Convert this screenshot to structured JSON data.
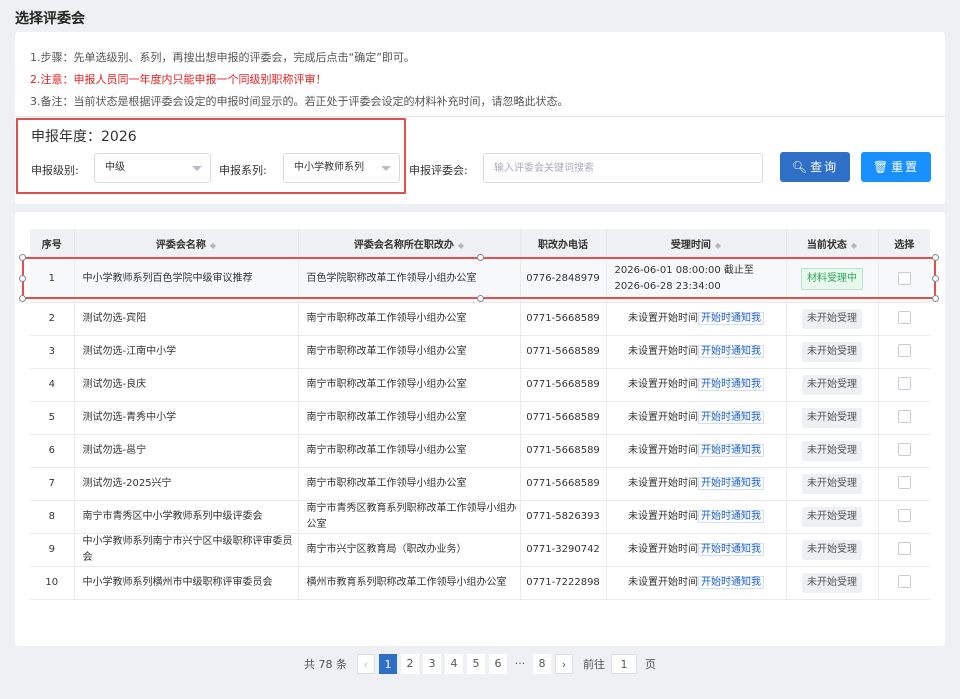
{
  "page_title": "选择评委会",
  "notes": {
    "step": "1.步骤：先单选级别、系列，再搜出想申报的评委会，完成后点击“确定”即可。",
    "warning": "2.注意：申报人员同一年度内只能申报一个同级别职称评审！",
    "remark": "3.备注：当前状态是根据评委会设定的申报时间显示的。若正处于评委会设定的材料补充时间，请忽略此状态。"
  },
  "filters": {
    "year_label": "申报年度：2026",
    "level_label": "申报级别:",
    "level_value": "中级",
    "series_label": "申报系列:",
    "series_value": "中小学教师系列",
    "committee_label": "申报评委会:",
    "committee_placeholder": "输入评委会关键词搜索",
    "query_button": "查询",
    "reset_button": "重置"
  },
  "table": {
    "headers": {
      "index": "序号",
      "name": "评委会名称",
      "office": "评委会名称所在职改办",
      "phone": "职改办电话",
      "time": "受理时间",
      "status": "当前状态",
      "select": "选择"
    },
    "rows": [
      {
        "index": "1",
        "name": "中小学教师系列百色学院中级审议推荐",
        "office": "百色学院职称改革工作领导小组办公室",
        "phone": "0776-2848979",
        "time": "2026-06-01 08:00:00 截止至 2026-06-28 23:34:00",
        "link": "",
        "status": "材料受理中"
      },
      {
        "index": "2",
        "name": "测试勿选-宾阳",
        "office": "南宁市职称改革工作领导小组办公室",
        "phone": "0771-5668589",
        "time": "未设置开始时间",
        "link": "开始时通知我",
        "status": "未开始受理"
      },
      {
        "index": "3",
        "name": "测试勿选-江南中小学",
        "office": "南宁市职称改革工作领导小组办公室",
        "phone": "0771-5668589",
        "time": "未设置开始时间",
        "link": "开始时通知我",
        "status": "未开始受理"
      },
      {
        "index": "4",
        "name": "测试勿选-良庆",
        "office": "南宁市职称改革工作领导小组办公室",
        "phone": "0771-5668589",
        "time": "未设置开始时间",
        "link": "开始时通知我",
        "status": "未开始受理"
      },
      {
        "index": "5",
        "name": "测试勿选-青秀中小学",
        "office": "南宁市职称改革工作领导小组办公室",
        "phone": "0771-5668589",
        "time": "未设置开始时间",
        "link": "开始时通知我",
        "status": "未开始受理"
      },
      {
        "index": "6",
        "name": "测试勿选-邕宁",
        "office": "南宁市职称改革工作领导小组办公室",
        "phone": "0771-5668589",
        "time": "未设置开始时间",
        "link": "开始时通知我",
        "status": "未开始受理"
      },
      {
        "index": "7",
        "name": "测试勿选-2025兴宁",
        "office": "南宁市职称改革工作领导小组办公室",
        "phone": "0771-5668589",
        "time": "未设置开始时间",
        "link": "开始时通知我",
        "status": "未开始受理"
      },
      {
        "index": "8",
        "name": "南宁市青秀区中小学教师系列中级评委会",
        "office": "南宁市青秀区教育系列职称改革工作领导小组办公室",
        "phone": "0771-5826393",
        "time": "未设置开始时间",
        "link": "开始时通知我",
        "status": "未开始受理"
      },
      {
        "index": "9",
        "name": "中小学教师系列南宁市兴宁区中级职称评审委员会",
        "office": "南宁市兴宁区教育局（职改办业务）",
        "phone": "0771-3290742",
        "time": "未设置开始时间",
        "link": "开始时通知我",
        "status": "未开始受理"
      },
      {
        "index": "10",
        "name": "中小学教师系列横州市中级职称评审委员会",
        "office": "横州市教育系列职称改革工作领导小组办公室",
        "phone": "0771-7222898",
        "time": "未设置开始时间",
        "link": "开始时通知我",
        "status": "未开始受理"
      }
    ]
  },
  "pagination": {
    "total": "共 78 条",
    "pages": [
      "1",
      "2",
      "3",
      "4",
      "5",
      "6",
      "···",
      "8"
    ],
    "goto_label": "前往",
    "goto_value": "1",
    "page_suffix": "页"
  }
}
